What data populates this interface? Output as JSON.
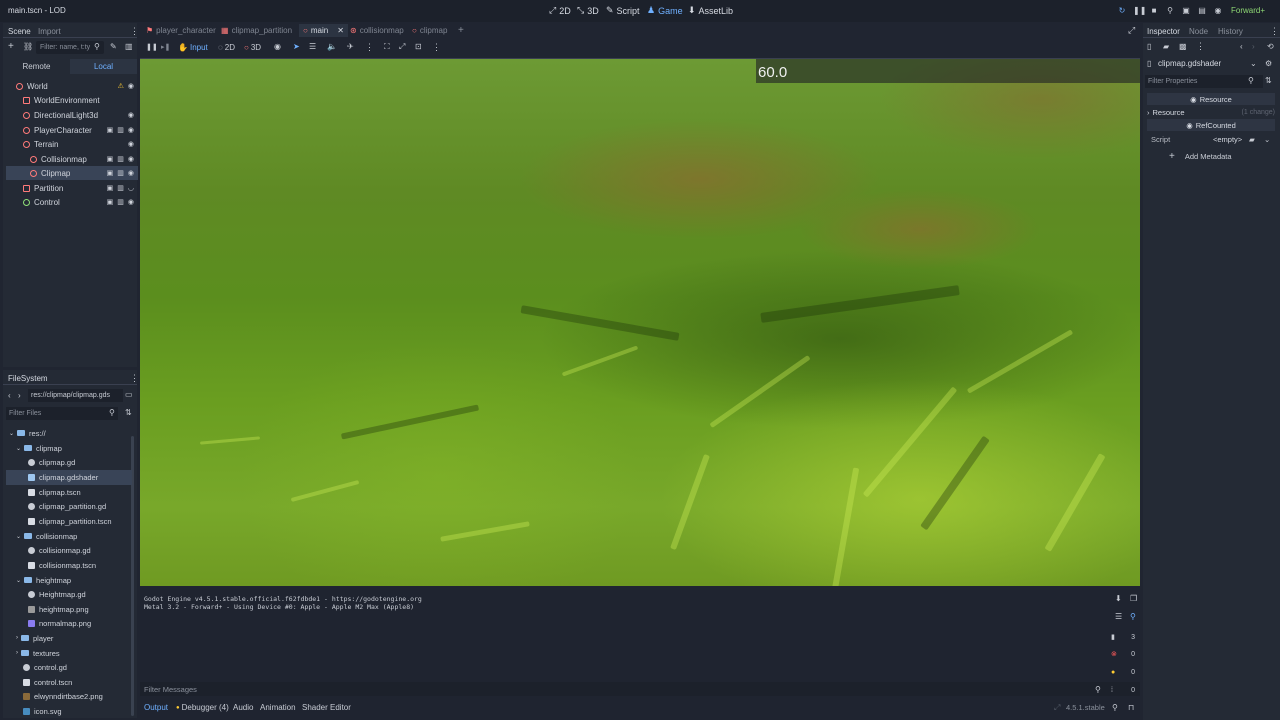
{
  "window": {
    "title": "main.tscn - LOD",
    "workspaces": [
      "2D",
      "3D",
      "Script",
      "Game",
      "AssetLib"
    ],
    "active_workspace": "Game",
    "renderer": "Forward+"
  },
  "scene_dock": {
    "tabs": [
      "Scene",
      "Import"
    ],
    "filter_placeholder": "Filter: name, t:ty",
    "remote_label": "Remote",
    "local_label": "Local",
    "nodes": [
      {
        "label": "World",
        "depth": 0
      },
      {
        "label": "WorldEnvironment",
        "depth": 1
      },
      {
        "label": "DirectionalLight3d",
        "depth": 1
      },
      {
        "label": "PlayerCharacter",
        "depth": 1
      },
      {
        "label": "Terrain",
        "depth": 1
      },
      {
        "label": "Collisionmap",
        "depth": 2
      },
      {
        "label": "Clipmap",
        "depth": 2
      },
      {
        "label": "Partition",
        "depth": 1
      },
      {
        "label": "Control",
        "depth": 1
      }
    ]
  },
  "filesystem": {
    "title": "FileSystem",
    "path": "res://clipmap/clipmap.gds",
    "filter_placeholder": "Filter Files",
    "items": [
      {
        "label": "res://",
        "type": "folder",
        "depth": 0
      },
      {
        "label": "clipmap",
        "type": "folder",
        "depth": 1
      },
      {
        "label": "clipmap.gd",
        "type": "gd",
        "depth": 2
      },
      {
        "label": "clipmap.gdshader",
        "type": "shader",
        "depth": 2
      },
      {
        "label": "clipmap.tscn",
        "type": "tscn",
        "depth": 2
      },
      {
        "label": "clipmap_partition.gd",
        "type": "gd",
        "depth": 2
      },
      {
        "label": "clipmap_partition.tscn",
        "type": "tscn",
        "depth": 2
      },
      {
        "label": "collisionmap",
        "type": "folder",
        "depth": 1
      },
      {
        "label": "collisionmap.gd",
        "type": "gd",
        "depth": 2
      },
      {
        "label": "collisionmap.tscn",
        "type": "tscn",
        "depth": 2
      },
      {
        "label": "heightmap",
        "type": "folder",
        "depth": 1
      },
      {
        "label": "Heightmap.gd",
        "type": "gd",
        "depth": 2
      },
      {
        "label": "heightmap.png",
        "type": "png",
        "depth": 2
      },
      {
        "label": "normalmap.png",
        "type": "png2",
        "depth": 2
      },
      {
        "label": "player",
        "type": "folder",
        "depth": 1
      },
      {
        "label": "textures",
        "type": "folder",
        "depth": 1
      },
      {
        "label": "control.gd",
        "type": "gd",
        "depth": 1
      },
      {
        "label": "control.tscn",
        "type": "tscn",
        "depth": 1
      },
      {
        "label": "elwynndirtbase2.png",
        "type": "png3",
        "depth": 1
      },
      {
        "label": "icon.svg",
        "type": "svg",
        "depth": 1
      }
    ]
  },
  "editor_tabs": [
    "player_character",
    "clipmap_partition",
    "main",
    "collisionmap",
    "clipmap"
  ],
  "active_editor_tab": "main",
  "game_toolbar": {
    "input_label": "Input",
    "mode_2d": "2D",
    "mode_3d": "3D"
  },
  "viewport": {
    "fps": "60.0"
  },
  "output": {
    "lines": [
      "Godot Engine v4.5.1.stable.official.f62fdbde1 - https://godotengine.org",
      "Metal 3.2 - Forward+ - Using Device #0: Apple - Apple M2 Max (Apple8)"
    ],
    "filter_placeholder": "Filter Messages",
    "counters": [
      "3",
      "0",
      "0",
      "0"
    ],
    "bottom_tabs": [
      "Output",
      "Debugger (4)",
      "Audio",
      "Animation",
      "Shader Editor"
    ],
    "version": "4.5.1.stable"
  },
  "inspector": {
    "tabs": [
      "Inspector",
      "Node",
      "History"
    ],
    "resource_name": "clipmap.gdshader",
    "filter_placeholder": "Filter Properties",
    "section_resource": "Resource",
    "category_resource": "Resource",
    "change_note": "(1 change)",
    "section_refcounted": "RefCounted",
    "script_label": "Script",
    "script_value": "<empty>",
    "add_metadata": "Add Metadata"
  }
}
